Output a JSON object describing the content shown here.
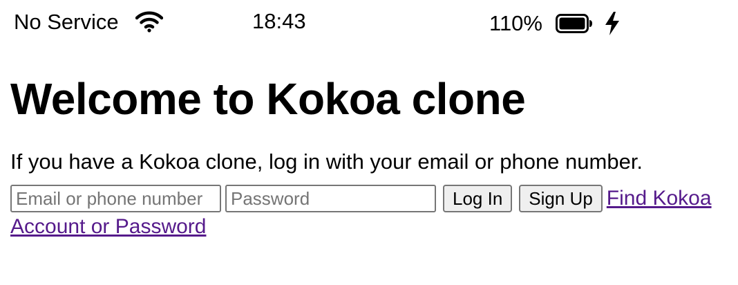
{
  "status_bar": {
    "carrier": "No Service",
    "time": "18:43",
    "battery_percent": "110%",
    "icons": [
      "wifi-icon",
      "battery-icon",
      "charging-bolt-icon"
    ]
  },
  "page": {
    "title": "Welcome to Kokoa clone",
    "intro": "If you have a Kokoa clone, log in with your email or phone number."
  },
  "login_form": {
    "email_placeholder": "Email or phone number",
    "email_value": "",
    "password_placeholder": "Password",
    "password_value": "",
    "login_label": "Log In",
    "signup_label": "Sign Up",
    "find_link": "Find Kokoa Account or Password"
  },
  "colors": {
    "link_visited": "#551a8b",
    "input_border": "#767676",
    "button_bg": "#efefef",
    "placeholder": "#757575"
  }
}
